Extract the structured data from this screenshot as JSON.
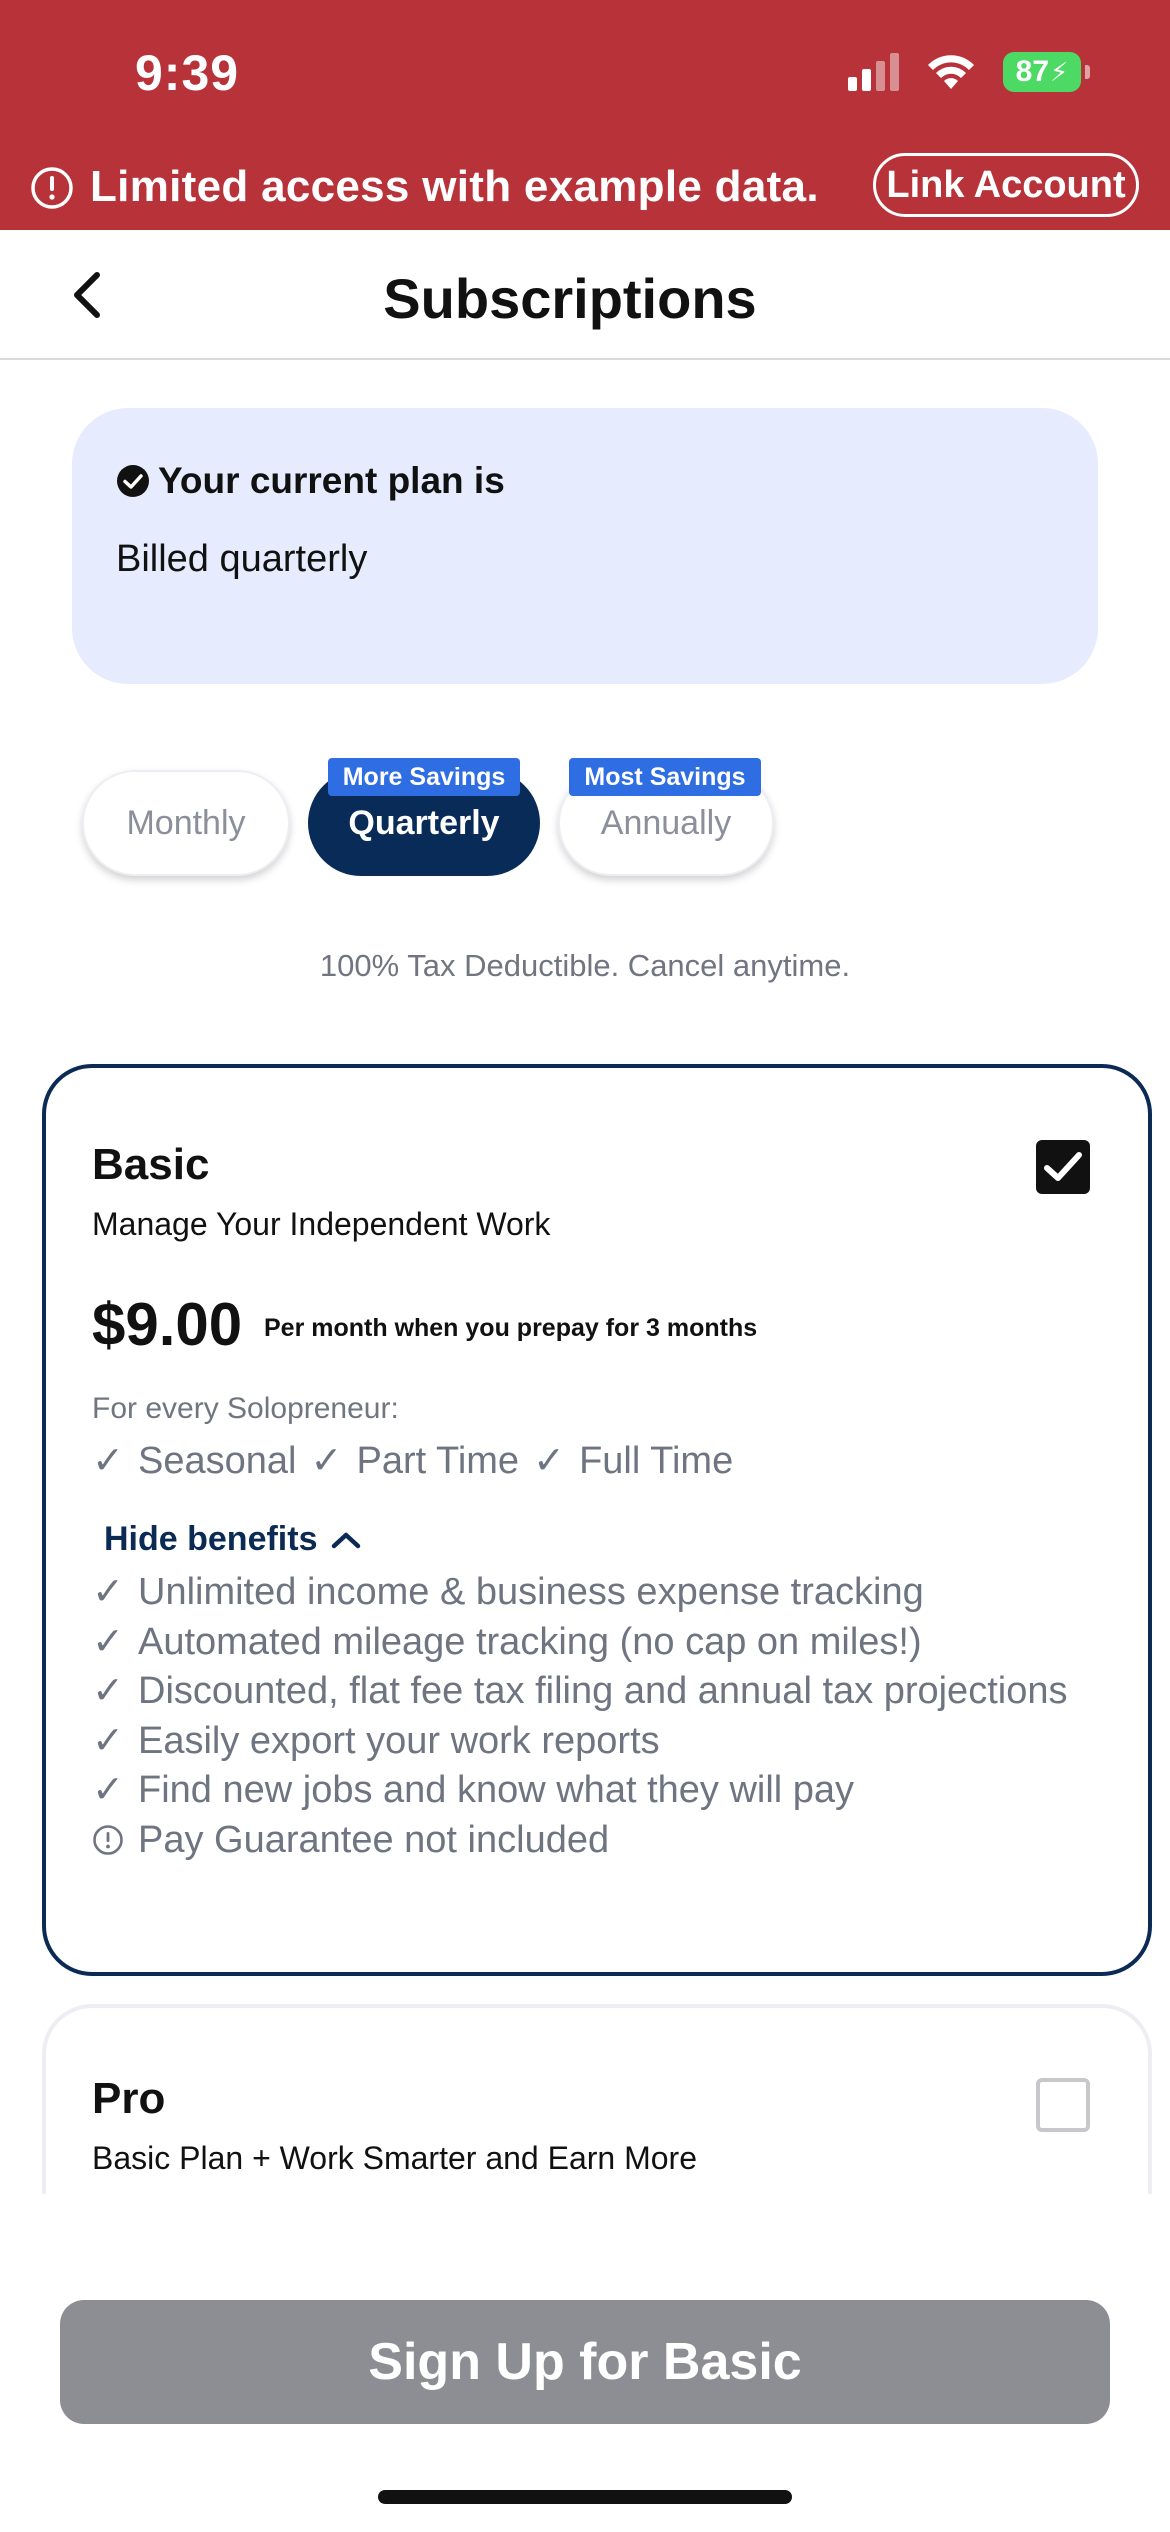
{
  "status_bar": {
    "time": "9:39",
    "battery": "87",
    "icons": [
      "cellular-signal-icon",
      "wifi-icon",
      "battery-charging-icon"
    ]
  },
  "banner": {
    "icon": "alert-circle-icon",
    "message": "Limited access with example data.",
    "link_label": "Link Account"
  },
  "header": {
    "title": "Subscriptions",
    "back_icon": "chevron-left-icon"
  },
  "current_plan": {
    "heading": "Your current plan is",
    "detail": "Billed quarterly"
  },
  "billing": {
    "options": [
      {
        "label": "Monthly",
        "selected": false,
        "badge": ""
      },
      {
        "label": "Quarterly",
        "selected": true,
        "badge": "More Savings"
      },
      {
        "label": "Annually",
        "selected": false,
        "badge": "Most Savings"
      }
    ],
    "note": "100% Tax Deductible. Cancel anytime."
  },
  "plans": [
    {
      "name": "Basic",
      "tagline": "Manage Your Independent Work",
      "selected": true,
      "price": "$9.00",
      "price_note": "Per month when you prepay for 3 months",
      "for_label": "For every Solopreneur:",
      "types": [
        "Seasonal",
        "Part Time",
        "Full Time"
      ],
      "toggle_label": "Hide benefits",
      "benefits": [
        {
          "icon": "check-icon",
          "text": "Unlimited income & business expense tracking"
        },
        {
          "icon": "check-icon",
          "text": "Automated mileage tracking (no cap on miles!)"
        },
        {
          "icon": "check-icon",
          "text": "Discounted, flat fee tax filing and annual tax projections"
        },
        {
          "icon": "check-icon",
          "text": "Easily export your work reports"
        },
        {
          "icon": "check-icon",
          "text": "Find new jobs and know what they will pay"
        },
        {
          "icon": "alert-circle-icon",
          "text": "Pay Guarantee not included"
        }
      ]
    },
    {
      "name": "Pro",
      "tagline": "Basic Plan + Work Smarter and Earn More",
      "selected": false
    }
  ],
  "cta": {
    "label": "Sign Up for Basic"
  },
  "colors": {
    "banner_red": "#b83339",
    "navy": "#0b2a54",
    "badge_blue": "#2f6de2",
    "current_plan_bg": "#e6ebfd",
    "cta_disabled": "#8d8e94"
  }
}
